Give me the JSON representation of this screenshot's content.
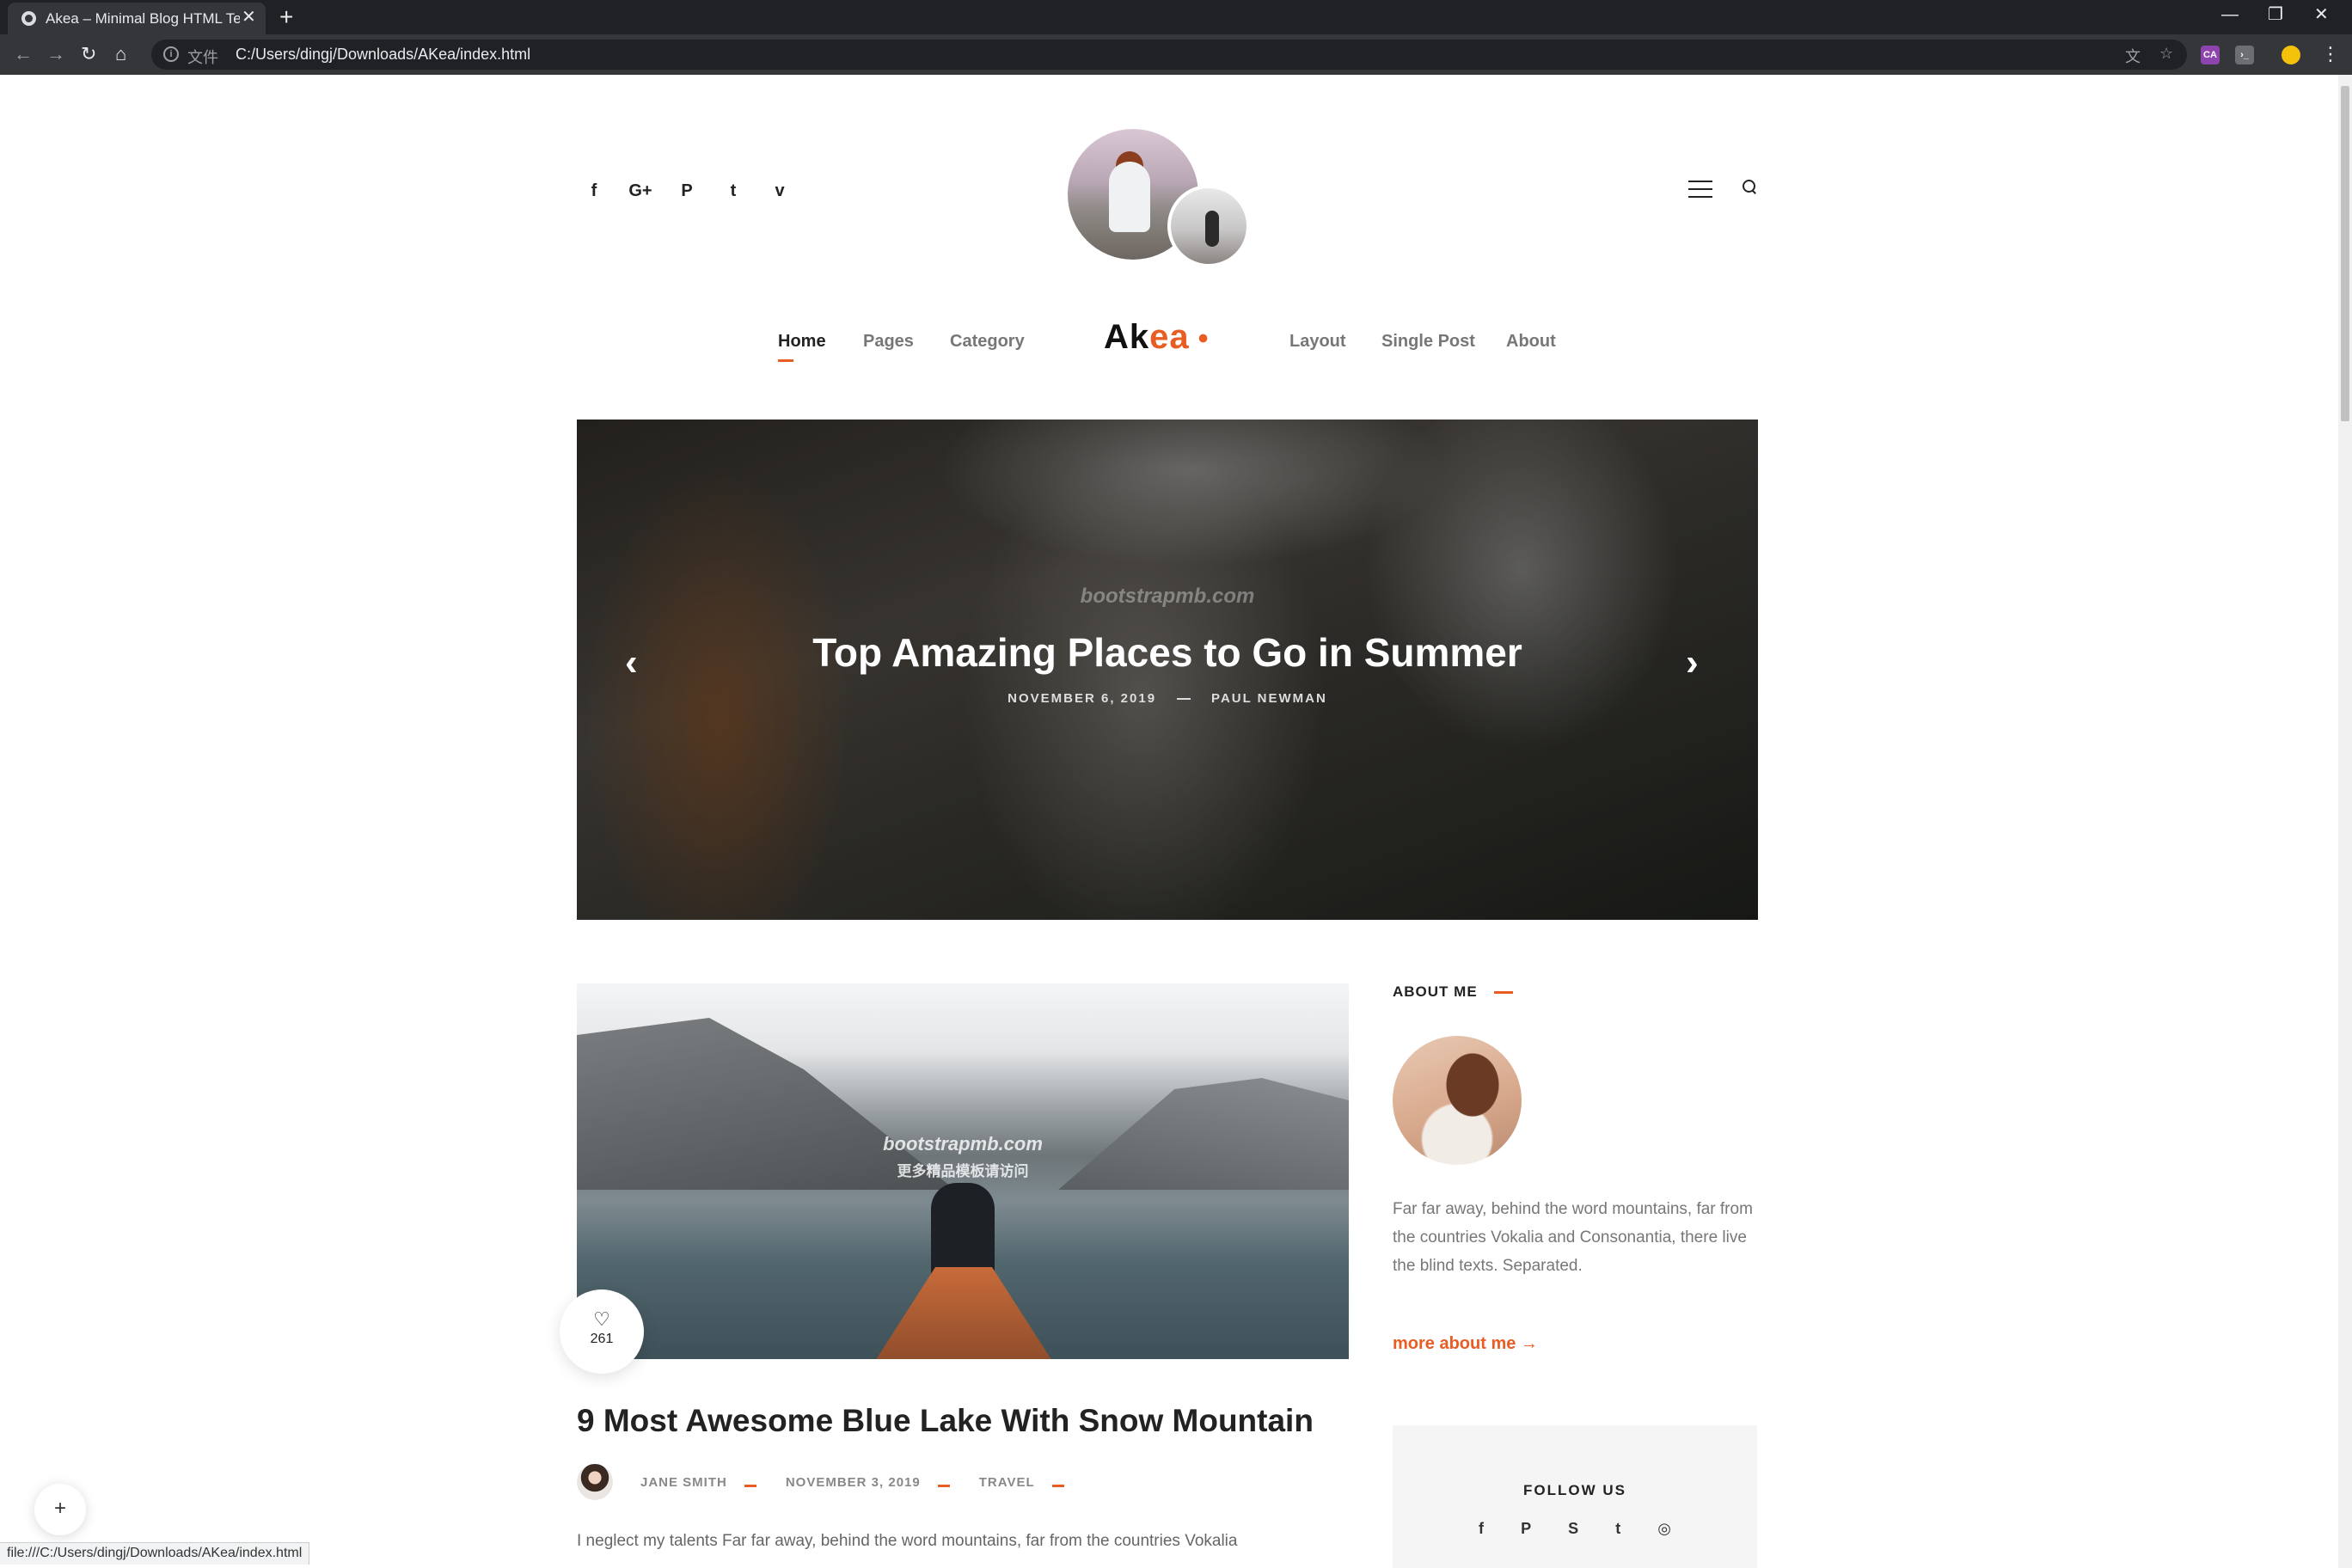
{
  "browser": {
    "tab_title": "Akea – Minimal Blog HTML Te",
    "tab_close": "✕",
    "new_tab": "+",
    "url_scheme": "文件",
    "url": "C:/Users/dingj/Downloads/AKea/index.html",
    "status_url": "file:///C:/Users/dingj/Downloads/AKea/index.html",
    "nav_icons": [
      "back-icon",
      "forward-icon",
      "reload-icon",
      "home-icon"
    ],
    "window_controls": [
      "minimize-icon",
      "restore-icon",
      "close-icon"
    ],
    "extension_labels": [
      "CA"
    ]
  },
  "header": {
    "social_icons": [
      "f",
      "G+",
      "P",
      "t",
      "v"
    ],
    "social_names": [
      "facebook-icon",
      "google-plus-icon",
      "pinterest-icon",
      "twitter-icon",
      "vimeo-icon"
    ],
    "brand_prefix": "Ak",
    "brand_accent": "ea",
    "brand_dot": "•"
  },
  "nav": {
    "items_left": [
      "Home",
      "Pages",
      "Category"
    ],
    "items_right": [
      "Layout",
      "Single Post",
      "About"
    ],
    "active": "Home"
  },
  "hero": {
    "title": "Top Amazing Places to Go in Summer",
    "date": "NOVEMBER 6, 2019",
    "author": "PAUL NEWMAN",
    "watermark": "bootstrapmb.com",
    "prev": "‹",
    "next": "›"
  },
  "post": {
    "likes": "261",
    "title": "9 Most Awesome Blue Lake With Snow Mountain",
    "author": "JANE SMITH",
    "date": "NOVEMBER 3, 2019",
    "category": "TRAVEL",
    "excerpt": "I neglect my talents Far far away, behind the word mountains, far from the countries Vokalia",
    "watermark": "bootstrapmb.com",
    "watermark_sub": "更多精品模板请访问"
  },
  "sidebar": {
    "about_heading": "ABOUT ME",
    "about_text": "Far far away, behind the word mountains, far from the countries Vokalia and Consonantia, there live the blind texts. Separated.",
    "more_link": "more about me  →",
    "follow_heading": "FOLLOW US",
    "follow_icons": [
      "f",
      "P",
      "S",
      "t",
      "◎"
    ]
  },
  "colors": {
    "accent": "#e85d24",
    "heading": "#222222",
    "muted": "#777777"
  }
}
